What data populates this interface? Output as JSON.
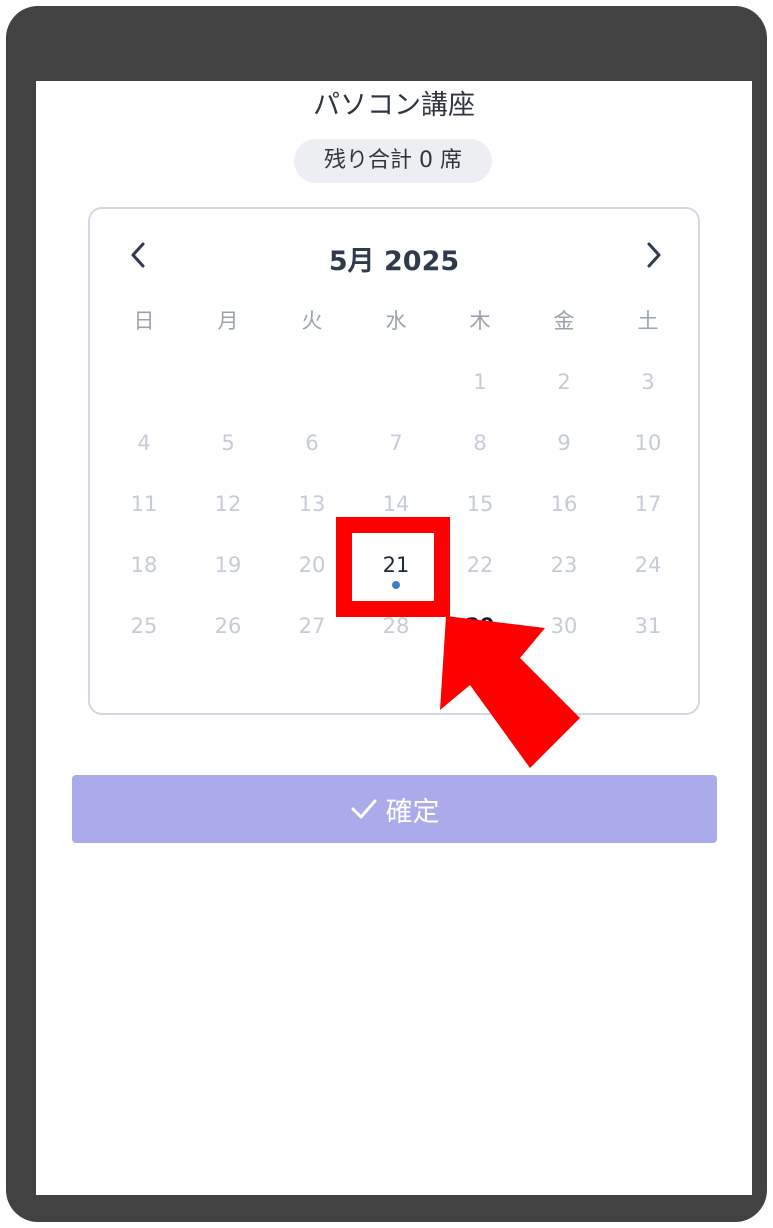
{
  "course": {
    "title": "パソコン講座",
    "remaining_badge": "残り合計 0 席"
  },
  "calendar": {
    "month_label": "5月 2025",
    "prev_icon": "chevron-left-icon",
    "next_icon": "chevron-right-icon",
    "weekdays": [
      "日",
      "月",
      "火",
      "水",
      "木",
      "金",
      "土"
    ],
    "weeks": [
      [
        "",
        "",
        "",
        "",
        "1",
        "2",
        "3"
      ],
      [
        "4",
        "5",
        "6",
        "7",
        "8",
        "9",
        "10"
      ],
      [
        "11",
        "12",
        "13",
        "14",
        "15",
        "16",
        "17"
      ],
      [
        "18",
        "19",
        "20",
        "21",
        "22",
        "23",
        "24"
      ],
      [
        "25",
        "26",
        "27",
        "28",
        "29",
        "30",
        "31"
      ]
    ],
    "available_date": "21",
    "emphasized_date": "29"
  },
  "actions": {
    "confirm_label": "確定",
    "confirm_icon": "check-icon"
  },
  "colors": {
    "frame": "#424242",
    "confirm_button": "#ababeb",
    "available_dot": "#3b82c4",
    "annotation": "#ff0000"
  }
}
